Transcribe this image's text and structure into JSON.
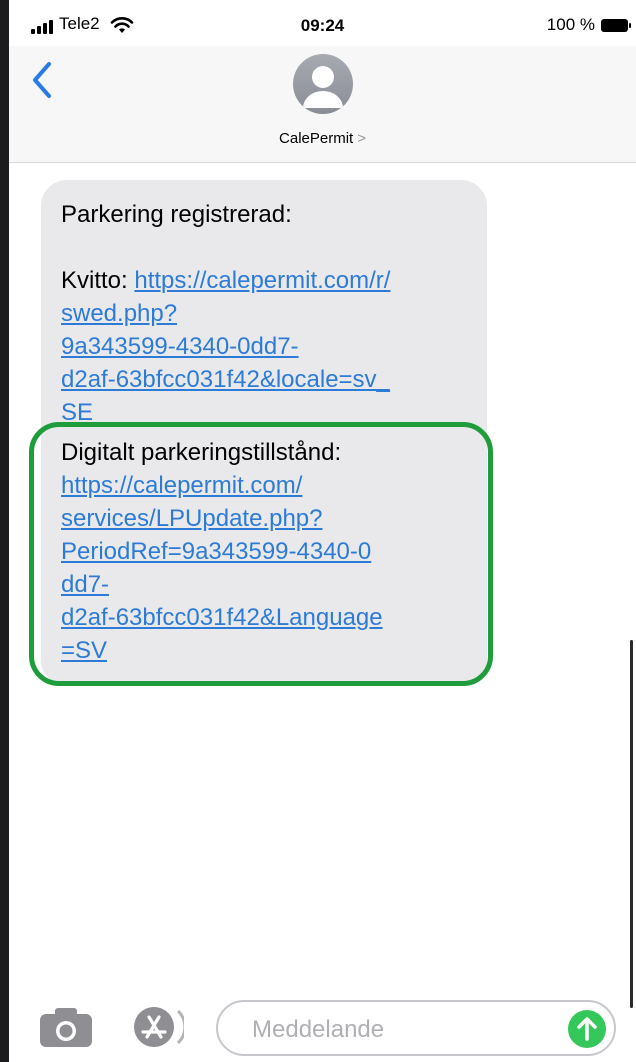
{
  "status_bar": {
    "carrier": "Tele2",
    "time": "09:24",
    "battery": "100 %"
  },
  "header": {
    "contact_name": "CalePermit",
    "contact_chevron": ">"
  },
  "message": {
    "title": "Parkering registrerad:",
    "receipt_label": "Kvitto:",
    "receipt_link_lines": [
      "https://calepermit.com/r/",
      "swed.php?",
      "9a343599-4340-0dd7-",
      "d2af-63bfcc031f42&locale=sv_",
      "SE"
    ],
    "permit_label": "Digitalt parkeringstillstånd:",
    "permit_link_lines": [
      "https://calepermit.com/",
      "services/LPUpdate.php?",
      "PeriodRef=9a343599-4340-0",
      "dd7-",
      "d2af-63bfcc031f42&Language",
      "=SV"
    ]
  },
  "compose": {
    "placeholder": "Meddelande"
  },
  "colors": {
    "link": "#2c7bd6",
    "highlight_border": "#1f9d3c",
    "send_button": "#34c759",
    "bubble": "#e9e9eb"
  },
  "icons": [
    "signal-icon",
    "wifi-icon",
    "battery-icon",
    "back-chevron-icon",
    "contact-avatar-icon",
    "camera-icon",
    "app-store-icon",
    "send-arrow-icon"
  ]
}
